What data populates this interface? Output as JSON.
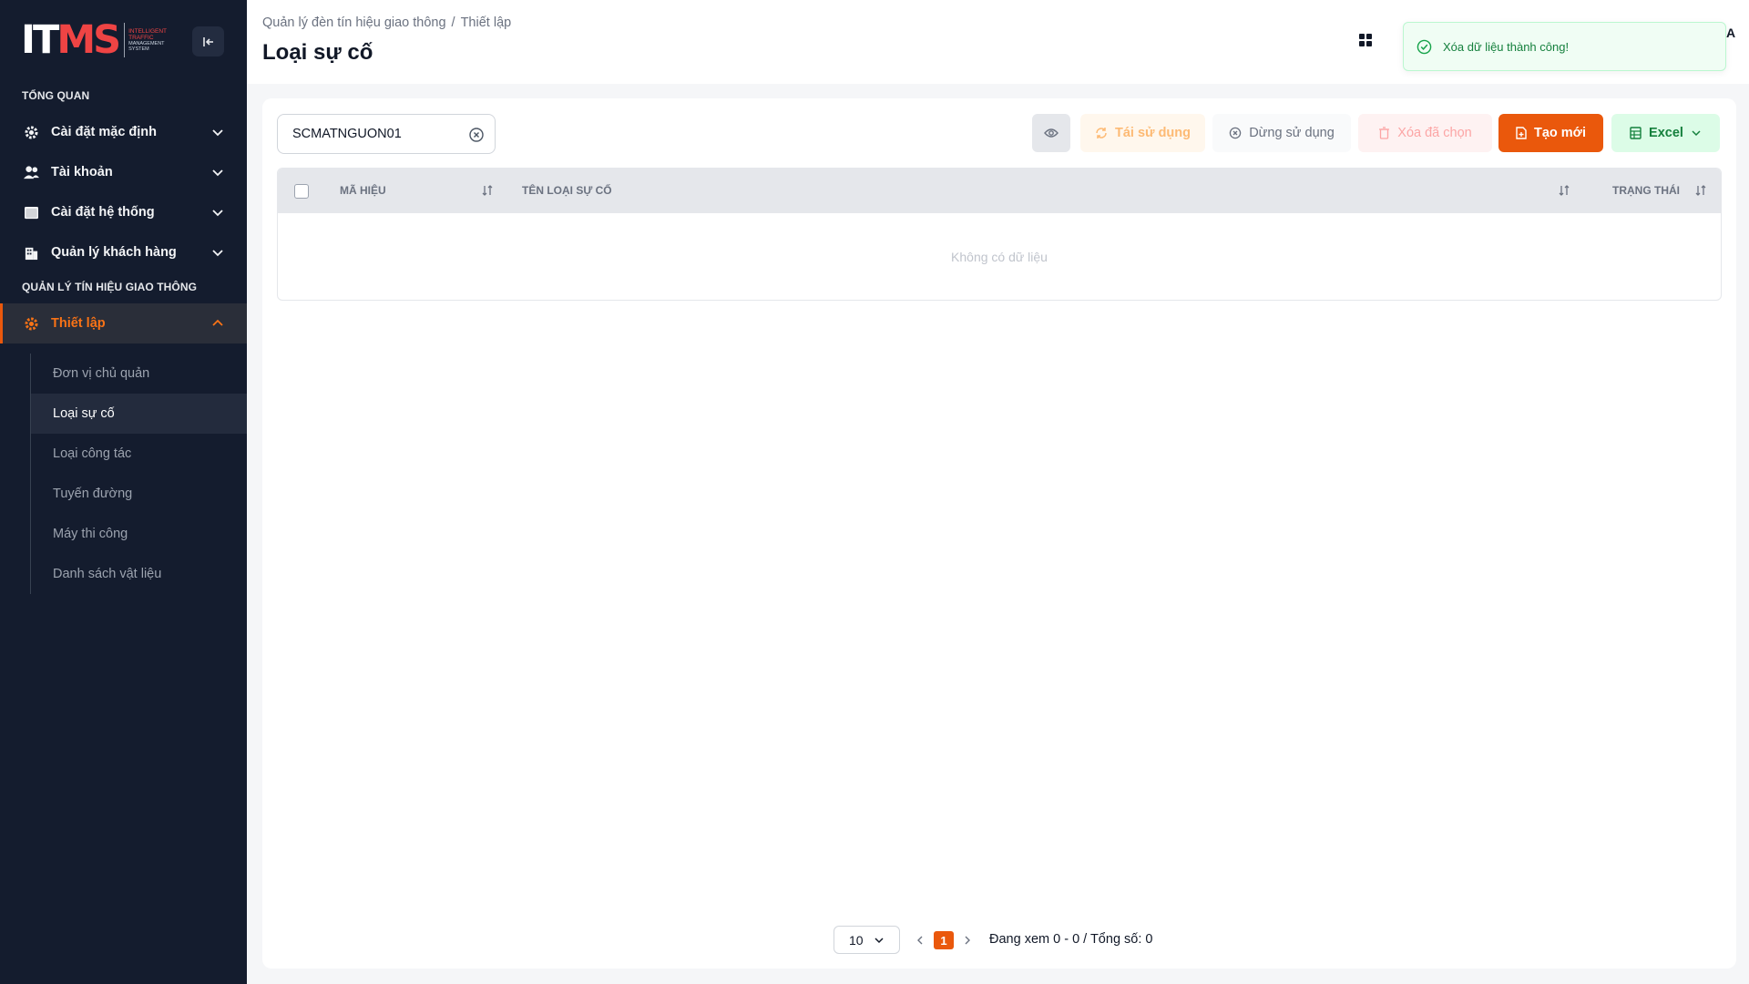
{
  "sidebar": {
    "logo": {
      "mark_main": "IT",
      "mark_accent": "MS",
      "lines": [
        "INTELLIGENT",
        "TRAFFIC",
        "MANAGEMENT",
        "SYSTEM"
      ]
    },
    "section_overview": "TỔNG QUAN",
    "section_traffic": "QUẢN LÝ TÍN HIỆU GIAO THÔNG",
    "items": [
      {
        "label": "Cài đặt mặc định",
        "icon": "gear-icon"
      },
      {
        "label": "Tài khoản",
        "icon": "users-icon"
      },
      {
        "label": "Cài đặt hệ thống",
        "icon": "window-icon"
      },
      {
        "label": "Quản lý khách hàng",
        "icon": "building-icon"
      },
      {
        "label": "Thiết lập",
        "icon": "gear-icon"
      }
    ],
    "submenu": [
      {
        "label": "Đơn vị chủ quản"
      },
      {
        "label": "Loại sự cố"
      },
      {
        "label": "Loại công tác"
      },
      {
        "label": "Tuyến đường"
      },
      {
        "label": "Máy thi công"
      },
      {
        "label": "Danh sách vật liệu"
      }
    ]
  },
  "header": {
    "breadcrumb": [
      "Quản lý đèn tín hiệu giao thông",
      "Thiết lập"
    ],
    "breadcrumb_sep": "/",
    "title": "Loại sự cố",
    "letter": "A"
  },
  "toast": {
    "message": "Xóa dữ liệu thành công!"
  },
  "toolbar": {
    "search_value": "SCMATNGUON01",
    "reuse_label": "Tái sử dụng",
    "stop_label": "Dừng sử dụng",
    "delete_label": "Xóa đã chọn",
    "create_label": "Tạo mới",
    "excel_label": "Excel"
  },
  "table": {
    "columns": [
      "MÃ HIỆU",
      "TÊN LOẠI SỰ CỐ",
      "TRẠNG THÁI"
    ],
    "empty_text": "Không có dữ liệu"
  },
  "pagination": {
    "page_size": "10",
    "current_page": "1",
    "info": "Đang xem 0 - 0 / Tổng số: 0"
  },
  "colors": {
    "accent": "#ea580c",
    "sidebar_bg": "#141c2e",
    "success": "#15803d"
  }
}
